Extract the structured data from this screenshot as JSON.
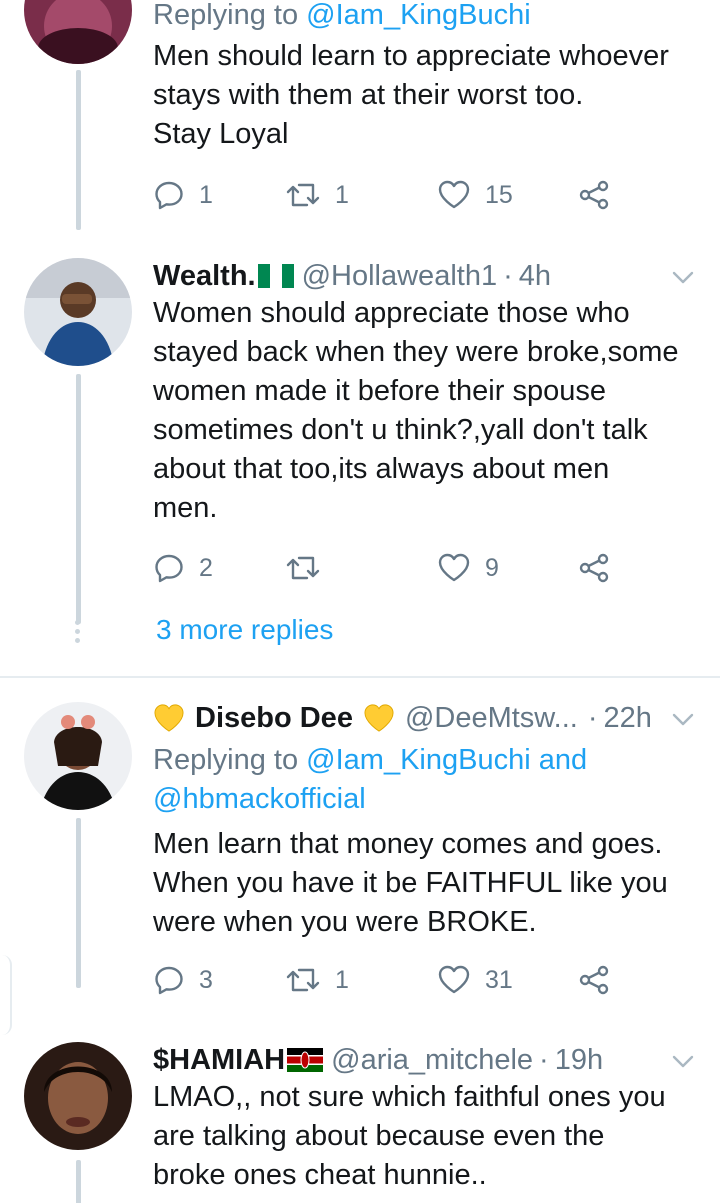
{
  "tweets": [
    {
      "replying_prefix": "Replying to ",
      "replying_to": "@Iam_KingBuchi",
      "text": "Men should learn to appreciate whoever\nstays with them at their worst too.\nStay Loyal",
      "replies": "1",
      "retweets": "1",
      "likes": "15"
    },
    {
      "name": "Wealth.",
      "flag": "nigeria-flag",
      "handle": "@Hollawealth1",
      "dot": "·",
      "time": "4h",
      "text": "Women should appreciate those who\nstayed back when they were broke,some\nwomen made it before their spouse\nsometimes don't u think?,yall don't talk\nabout that too,its always about men\nmen.",
      "replies": "2",
      "retweets": "",
      "likes": "9"
    },
    {
      "name": "Disebo Dee",
      "emoji": "yellow-heart",
      "handle": "@DeeMtsw...",
      "dot": "·",
      "time": "22h",
      "replying_prefix": "Replying to ",
      "replying_to": "@Iam_KingBuchi and",
      "replying_to_2": "@hbmackofficial",
      "text": "Men learn that money comes and goes.\nWhen you have it be FAITHFUL like you\nwere when you were BROKE.",
      "replies": "3",
      "retweets": "1",
      "likes": "31"
    },
    {
      "name": "$HAMIAH",
      "flag": "kenya-flag",
      "handle": "@aria_mitchele",
      "dot": "·",
      "time": "19h",
      "text": "LMAO,, not sure which faithful ones you\nare talking about because even the\nbroke ones cheat hunnie.."
    }
  ],
  "more_replies": "3 more replies",
  "colors": {
    "link": "#1da1f2",
    "muted": "#657786",
    "line": "#ccd6dd"
  }
}
